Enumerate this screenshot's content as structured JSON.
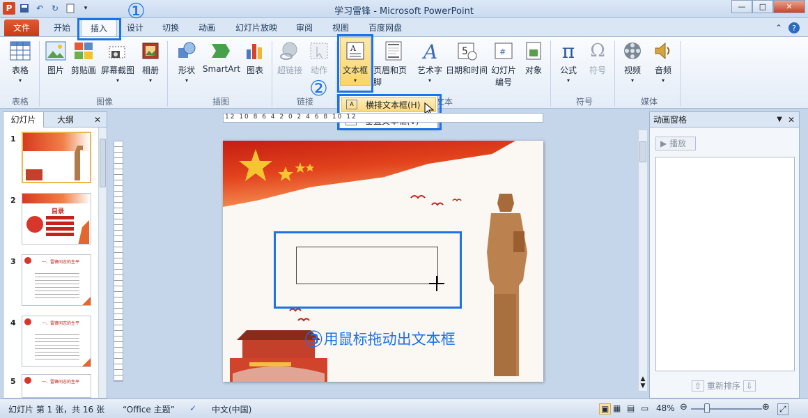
{
  "window": {
    "title": "学习雷锋 - Microsoft PowerPoint"
  },
  "qat": {
    "logo": "P",
    "save_icon": "save-icon",
    "undo_icon": "undo-icon",
    "redo_icon": "redo-icon",
    "new_icon": "new-icon"
  },
  "tabs": [
    "文件",
    "开始",
    "插入",
    "设计",
    "切换",
    "动画",
    "幻灯片放映",
    "审阅",
    "视图",
    "百度网盘"
  ],
  "ribbon": {
    "groups": [
      "表格",
      "图像",
      "插图",
      "链接",
      "文本",
      "符号",
      "媒体"
    ],
    "buttons": {
      "table": "表格",
      "picture": "图片",
      "clipart": "剪贴画",
      "screenshot": "屏幕截图",
      "album": "相册",
      "shapes": "形状",
      "smartart": "SmartArt",
      "chart": "图表",
      "hyperlink": "超链接",
      "action": "动作",
      "textbox": "文本框",
      "header": "页眉和页脚",
      "wordart": "艺术字",
      "datetime": "日期和时间",
      "slidenum_1": "幻灯片",
      "slidenum_2": "编号",
      "object": "对象",
      "equation": "公式",
      "symbol": "符号",
      "video": "视频",
      "audio": "音频"
    }
  },
  "dropdown": {
    "horizontal": "横排文本框(H)",
    "vertical": "垂直文本框(V)"
  },
  "annotations": {
    "step1": "①",
    "step2": "②",
    "step3_num": "③",
    "step3_text": "用鼠标拖动出文本框"
  },
  "left_pane": {
    "tabs": [
      "幻灯片",
      "大纲"
    ],
    "thumbnails": [
      "1",
      "2",
      "3",
      "4",
      "5"
    ],
    "slide2_title": "目录",
    "slide3_title": "一、雷锋同志的生平"
  },
  "ruler_labels": "12 10 8 6 4 2 0 2 4 6 8 10 12",
  "anim_pane": {
    "title": "动画窗格",
    "play": "播放",
    "reorder": "重新排序"
  },
  "status": {
    "slide": "幻灯片 第 1 张，共 16 张",
    "theme": "“Office 主题”",
    "lang": "中文(中国)",
    "zoom": "48%",
    "zoom_level": 0.48
  },
  "colors": {
    "accent_blue": "#1a73e8",
    "file_tab": "#d24726"
  }
}
